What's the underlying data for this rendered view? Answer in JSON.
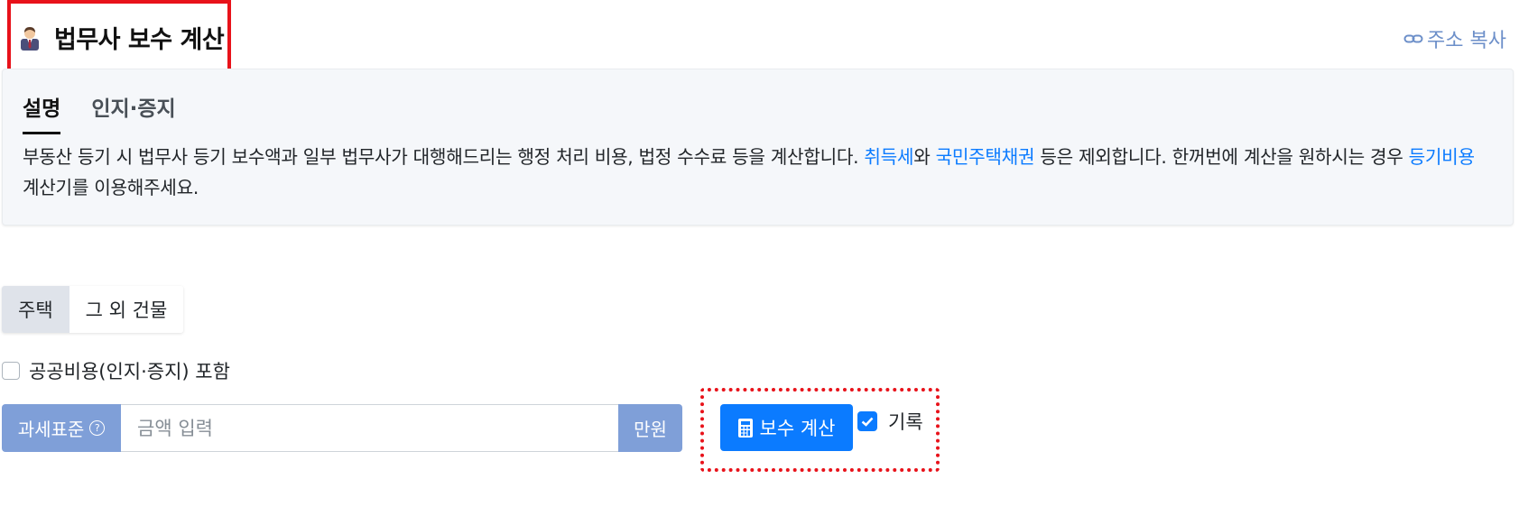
{
  "header": {
    "title": "법무사 보수 계산",
    "copy_link": "주소 복사",
    "icons": {
      "title": "person-with-tie-icon",
      "copy": "link-icon"
    }
  },
  "tabs": [
    {
      "label": "설명",
      "active": true
    },
    {
      "label": "인지·증지",
      "active": false
    }
  ],
  "description": {
    "part1": "부동산 등기 시 법무사 등기 보수액과 일부 법무사가 대행해드리는 행정 처리 비용, 법정 수수료 등을 계산합니다. ",
    "link1": "취득세",
    "part2": "와 ",
    "link2": "국민주택채권",
    "part3": " 등은 제외합니다. 한꺼번에 계산을 원하시는 경우 ",
    "link3": "등기비용",
    "part4": " 계산기를 이용해주세요."
  },
  "building_type": {
    "options": [
      "주택",
      "그 외 건물"
    ],
    "selected": "주택"
  },
  "public_cost": {
    "label": "공공비용(인지·증지) 포함",
    "checked": false
  },
  "amount": {
    "prefix": "과세표준",
    "help_icon": "question-circle-icon",
    "placeholder": "금액 입력",
    "value": "",
    "unit": "만원"
  },
  "calculate_button": {
    "label": "보수 계산",
    "icon": "calculator-icon"
  },
  "record": {
    "label": "기록",
    "checked": true
  },
  "colors": {
    "accent": "#0b7bff",
    "input_addon": "#7f9fd8",
    "highlight": "#e8121a",
    "link_secondary": "#6c8fc9"
  }
}
